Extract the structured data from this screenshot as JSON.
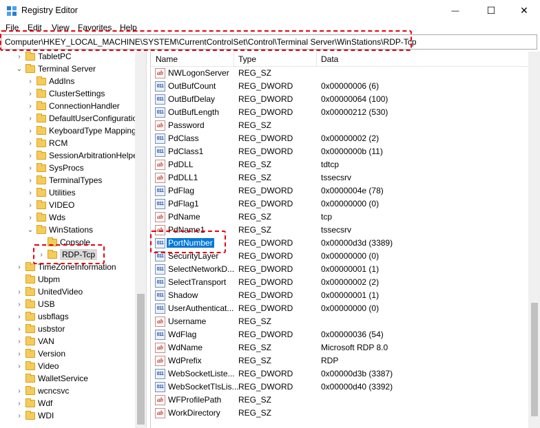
{
  "window": {
    "title": "Registry Editor",
    "controls": {
      "minimize": "—",
      "maximize": "☐",
      "close": "✕"
    }
  },
  "menu": [
    "File",
    "Edit",
    "View",
    "Favorites",
    "Help"
  ],
  "address": "Computer\\HKEY_LOCAL_MACHINE\\SYSTEM\\CurrentControlSet\\Control\\Terminal Server\\WinStations\\RDP-Tcp",
  "tree": [
    {
      "label": "TabletPC",
      "level": 1,
      "expander": "›"
    },
    {
      "label": "Terminal Server",
      "level": 1,
      "expander": "⌄"
    },
    {
      "label": "AddIns",
      "level": 2,
      "expander": "›"
    },
    {
      "label": "ClusterSettings",
      "level": 2,
      "expander": "›"
    },
    {
      "label": "ConnectionHandler",
      "level": 2,
      "expander": "›"
    },
    {
      "label": "DefaultUserConfiguratio",
      "level": 2,
      "expander": "›"
    },
    {
      "label": "KeyboardType Mapping",
      "level": 2,
      "expander": "›"
    },
    {
      "label": "RCM",
      "level": 2,
      "expander": "›"
    },
    {
      "label": "SessionArbitrationHelpe",
      "level": 2,
      "expander": "›"
    },
    {
      "label": "SysProcs",
      "level": 2,
      "expander": "›"
    },
    {
      "label": "TerminalTypes",
      "level": 2,
      "expander": "›"
    },
    {
      "label": "Utilities",
      "level": 2,
      "expander": "›"
    },
    {
      "label": "VIDEO",
      "level": 2,
      "expander": "›"
    },
    {
      "label": "Wds",
      "level": 2,
      "expander": "›"
    },
    {
      "label": "WinStations",
      "level": 2,
      "expander": "⌄"
    },
    {
      "label": "Console",
      "level": 3,
      "expander": ""
    },
    {
      "label": "RDP-Tcp",
      "level": 3,
      "expander": "›",
      "selected": true
    },
    {
      "label": "TimeZoneInformation",
      "level": 1,
      "expander": "›"
    },
    {
      "label": "Ubpm",
      "level": 1,
      "expander": ""
    },
    {
      "label": "UnitedVideo",
      "level": 1,
      "expander": "›"
    },
    {
      "label": "USB",
      "level": 1,
      "expander": "›"
    },
    {
      "label": "usbflags",
      "level": 1,
      "expander": "›"
    },
    {
      "label": "usbstor",
      "level": 1,
      "expander": "›"
    },
    {
      "label": "VAN",
      "level": 1,
      "expander": "›"
    },
    {
      "label": "Version",
      "level": 1,
      "expander": "›"
    },
    {
      "label": "Video",
      "level": 1,
      "expander": "›"
    },
    {
      "label": "WalletService",
      "level": 1,
      "expander": ""
    },
    {
      "label": "wcncsvc",
      "level": 1,
      "expander": "›"
    },
    {
      "label": "Wdf",
      "level": 1,
      "expander": "›"
    },
    {
      "label": "WDI",
      "level": 1,
      "expander": "›"
    }
  ],
  "columns": {
    "name": "Name",
    "type": "Type",
    "data": "Data"
  },
  "values": [
    {
      "name": "NWLogonServer",
      "type": "REG_SZ",
      "data": "",
      "kind": "sz"
    },
    {
      "name": "OutBufCount",
      "type": "REG_DWORD",
      "data": "0x00000006 (6)",
      "kind": "dw"
    },
    {
      "name": "OutBufDelay",
      "type": "REG_DWORD",
      "data": "0x00000064 (100)",
      "kind": "dw"
    },
    {
      "name": "OutBufLength",
      "type": "REG_DWORD",
      "data": "0x00000212 (530)",
      "kind": "dw"
    },
    {
      "name": "Password",
      "type": "REG_SZ",
      "data": "",
      "kind": "sz"
    },
    {
      "name": "PdClass",
      "type": "REG_DWORD",
      "data": "0x00000002 (2)",
      "kind": "dw"
    },
    {
      "name": "PdClass1",
      "type": "REG_DWORD",
      "data": "0x0000000b (11)",
      "kind": "dw"
    },
    {
      "name": "PdDLL",
      "type": "REG_SZ",
      "data": "tdtcp",
      "kind": "sz"
    },
    {
      "name": "PdDLL1",
      "type": "REG_SZ",
      "data": "tssecsrv",
      "kind": "sz"
    },
    {
      "name": "PdFlag",
      "type": "REG_DWORD",
      "data": "0x0000004e (78)",
      "kind": "dw"
    },
    {
      "name": "PdFlag1",
      "type": "REG_DWORD",
      "data": "0x00000000 (0)",
      "kind": "dw"
    },
    {
      "name": "PdName",
      "type": "REG_SZ",
      "data": "tcp",
      "kind": "sz"
    },
    {
      "name": "PdName1",
      "type": "REG_SZ",
      "data": "tssecsrv",
      "kind": "sz"
    },
    {
      "name": "PortNumber",
      "type": "REG_DWORD",
      "data": "0x00000d3d (3389)",
      "kind": "dw",
      "selected": true
    },
    {
      "name": "SecurityLayer",
      "type": "REG_DWORD",
      "data": "0x00000000 (0)",
      "kind": "dw"
    },
    {
      "name": "SelectNetworkD...",
      "type": "REG_DWORD",
      "data": "0x00000001 (1)",
      "kind": "dw"
    },
    {
      "name": "SelectTransport",
      "type": "REG_DWORD",
      "data": "0x00000002 (2)",
      "kind": "dw"
    },
    {
      "name": "Shadow",
      "type": "REG_DWORD",
      "data": "0x00000001 (1)",
      "kind": "dw"
    },
    {
      "name": "UserAuthenticat...",
      "type": "REG_DWORD",
      "data": "0x00000000 (0)",
      "kind": "dw"
    },
    {
      "name": "Username",
      "type": "REG_SZ",
      "data": "",
      "kind": "sz"
    },
    {
      "name": "WdFlag",
      "type": "REG_DWORD",
      "data": "0x00000036 (54)",
      "kind": "dw"
    },
    {
      "name": "WdName",
      "type": "REG_SZ",
      "data": "Microsoft RDP 8.0",
      "kind": "sz"
    },
    {
      "name": "WdPrefix",
      "type": "REG_SZ",
      "data": "RDP",
      "kind": "sz"
    },
    {
      "name": "WebSocketListe...",
      "type": "REG_DWORD",
      "data": "0x00000d3b (3387)",
      "kind": "dw"
    },
    {
      "name": "WebSocketTlsLis...",
      "type": "REG_DWORD",
      "data": "0x00000d40 (3392)",
      "kind": "dw"
    },
    {
      "name": "WFProfilePath",
      "type": "REG_SZ",
      "data": "",
      "kind": "sz"
    },
    {
      "name": "WorkDirectory",
      "type": "REG_SZ",
      "data": "",
      "kind": "sz"
    }
  ],
  "icons": {
    "string_value": "ab",
    "dword_value": "011"
  },
  "highlight_color": "#e3000f",
  "selection_color": "#0078d7"
}
